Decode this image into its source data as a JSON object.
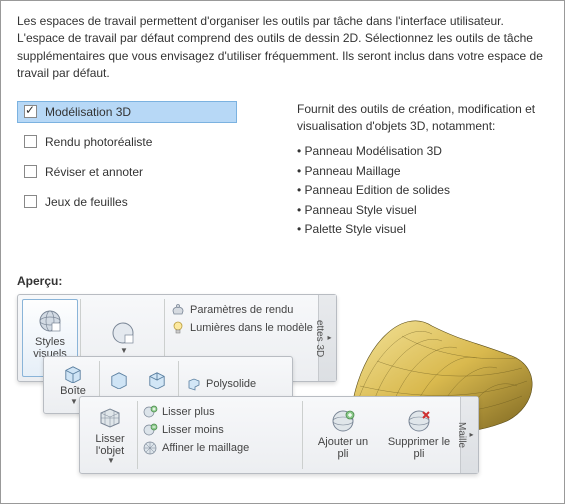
{
  "intro": "Les espaces de travail permettent d'organiser les outils par tâche dans l'interface utilisateur. L'espace de travail par défaut comprend des outils de dessin 2D. Sélectionnez les outils de tâche supplémentaires que vous envisagez d'utiliser fréquemment. Ils seront inclus dans votre espace de travail par défaut.",
  "options": {
    "items": [
      {
        "label": "Modélisation 3D",
        "checked": true,
        "selected": true
      },
      {
        "label": "Rendu photoréaliste",
        "checked": false,
        "selected": false
      },
      {
        "label": "Réviser et annoter",
        "checked": false,
        "selected": false
      },
      {
        "label": "Jeux de feuilles",
        "checked": false,
        "selected": false
      }
    ]
  },
  "description": {
    "lead": "Fournit des outils de création, modification et visualisation d'objets 3D, notamment:",
    "bullets": [
      "• Panneau Modélisation 3D",
      "• Panneau Maillage",
      "• Panneau Edition de solides",
      "• Panneau Style visuel",
      "• Palette Style visuel"
    ]
  },
  "preview_label": "Aperçu:",
  "panel1": {
    "big": "Styles visuels",
    "items": [
      "Paramètres de rendu",
      "Lumières dans le modèle"
    ],
    "tab": "ettes 3D"
  },
  "panel2": {
    "big": "Boîte",
    "item": "Polysolide"
  },
  "panel3": {
    "big": "Lisser l'objet",
    "list": [
      "Lisser plus",
      "Lisser moins",
      "Affiner le maillage"
    ],
    "btn1": "Ajouter un pli",
    "btn2": "Supprimer le pli",
    "tab": "Maille"
  }
}
